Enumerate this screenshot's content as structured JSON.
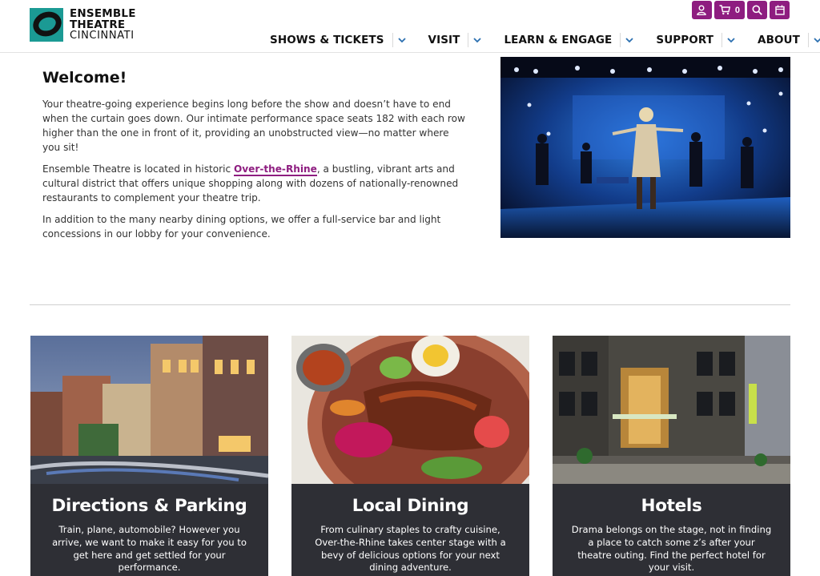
{
  "brand": {
    "line1": "ENSEMBLE",
    "line2": "THEATRE",
    "line3": "CINCINNATI"
  },
  "utility": {
    "cart_count": "0"
  },
  "nav": {
    "items": [
      {
        "label": "SHOWS & TICKETS"
      },
      {
        "label": "VISIT"
      },
      {
        "label": "LEARN & ENGAGE"
      },
      {
        "label": "SUPPORT"
      },
      {
        "label": "ABOUT"
      }
    ]
  },
  "welcome": {
    "heading": "Welcome!",
    "p1": "Your theatre-going experience begins long before the show and doesn’t have to end when the curtain goes down. Our intimate performance space seats 182 with each row higher than the one in front of it, providing an unobstructed view—no matter where you sit!",
    "p2_before": "Ensemble Theatre is located in historic ",
    "p2_link": "Over-the-Rhine",
    "p2_after": ", a bustling, vibrant arts and cultural district that offers unique shopping along with dozens of nationally-renowned restaurants to complement your theatre trip.",
    "p3": "In addition to the many nearby dining options, we offer a full-service bar and light concessions in our lobby for your convenience."
  },
  "cards": [
    {
      "title": "Directions & Parking",
      "desc": "Train, plane, automobile? However you arrive, we want to make it easy for you to get here and get settled for your performance."
    },
    {
      "title": "Local Dining",
      "desc": "From culinary staples to crafty cuisine, Over-the-Rhine takes center stage with a bevy of delicious options for your next dining adventure."
    },
    {
      "title": "Hotels",
      "desc": "Drama belongs on the stage, not in finding a place to catch some z’s after your theatre outing. Find the perfect hotel for your visit."
    }
  ],
  "colors": {
    "brand_purple": "#8e1d80",
    "brand_teal": "#1b9a94",
    "card_panel": "#2e2f35",
    "chevron_blue": "#2a6fb0"
  }
}
